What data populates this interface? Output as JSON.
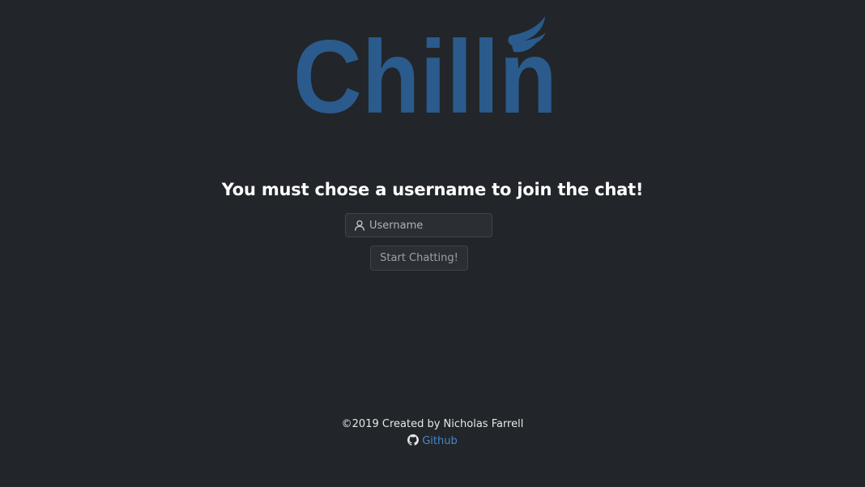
{
  "logo": {
    "text": "Chilln",
    "color": "#2a5b8c"
  },
  "headline": "You must chose a username to join the chat!",
  "username_field": {
    "placeholder": "Username",
    "value": "",
    "icon": "user-icon"
  },
  "start_button": {
    "label": "Start Chatting!"
  },
  "footer": {
    "credit": "©2019 Created by Nicholas Farrell",
    "link_label": "Github",
    "link_icon": "github-icon",
    "link_color": "#4a86c7"
  },
  "colors": {
    "background": "#222529",
    "text": "#ffffff"
  }
}
